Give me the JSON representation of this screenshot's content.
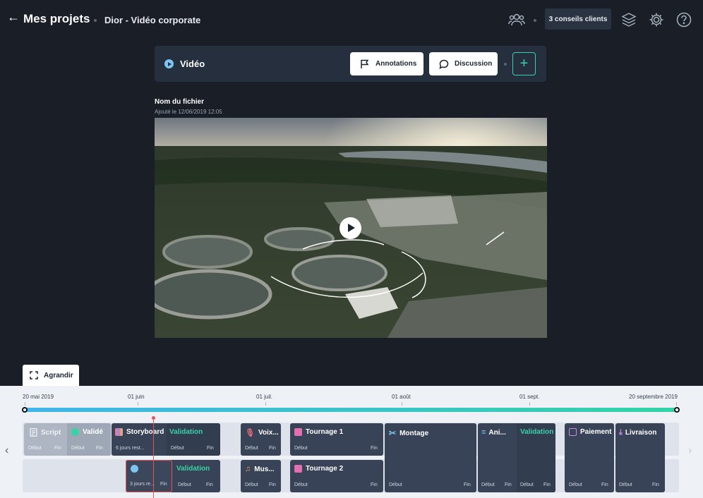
{
  "header": {
    "title": "Mes projets",
    "project": "Dior - Vidéo corporate",
    "conseils": "3 conseils clients",
    "icons": [
      "back-arrow-icon",
      "team-icon",
      "cube-icon",
      "settings-icon",
      "help-icon"
    ]
  },
  "toolbar": {
    "label": "Vidéo",
    "annotations": "Annotations",
    "discussion": "Discussion",
    "add": "+"
  },
  "file": {
    "name": "Nom du fichier",
    "added": "Ajouté le 12/06/2019   12:05"
  },
  "timeline": {
    "expand_label": "Agrandir",
    "dates": [
      "20 mai 2019",
      "01 juin",
      "01 juil.",
      "01 août",
      "01 sept.",
      "20 septembre 2019"
    ],
    "labels": {
      "debut": "Début",
      "fin": "Fin"
    },
    "row1": {
      "script": "Script",
      "valide": "Validé",
      "storyboard": "Storyboard",
      "storyboard_remaining": "6 jours rest...",
      "validation": "Validation",
      "voix": "Voix...",
      "tournage1": "Tournage 1",
      "montage": "Montage",
      "ani": "Ani...",
      "validation2": "Validation",
      "paiement": "Paiement",
      "livraison": "Livraison"
    },
    "row2": {
      "video_remaining": "3 jours re...",
      "validation": "Validation",
      "musique": "Mus...",
      "tournage2": "Tournage 2"
    }
  },
  "colors": {
    "accent_green": "#38d2a9",
    "accent_blue": "#40b5ea",
    "background": "#191e27",
    "task": "#384357",
    "cursor": "#e05656"
  }
}
